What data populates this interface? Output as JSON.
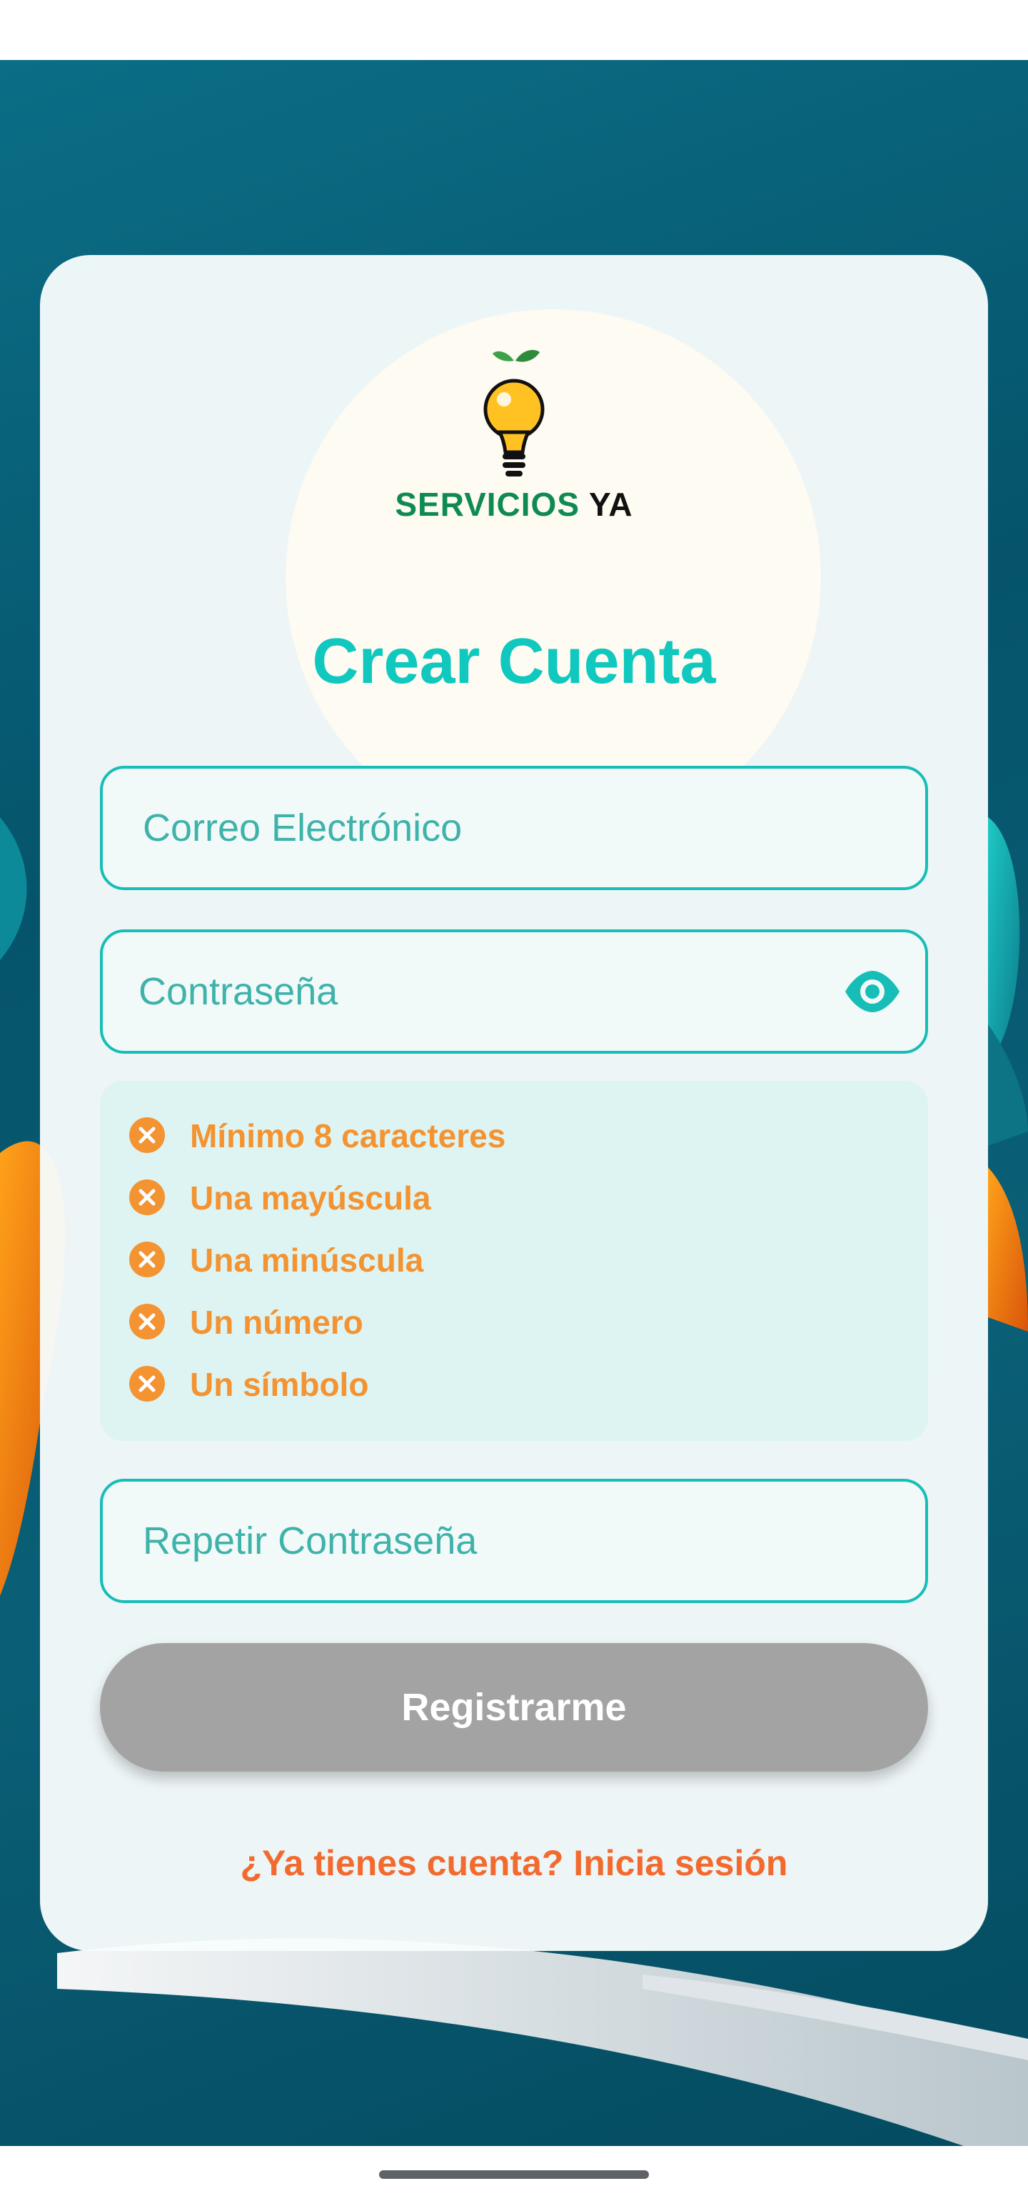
{
  "brand": {
    "word1": "SERVICIOS",
    "word2": "YA"
  },
  "form": {
    "title": "Crear Cuenta",
    "email_placeholder": "Correo Electrónico",
    "password_placeholder": "Contraseña",
    "repeat_placeholder": "Repetir Contraseña",
    "submit_label": "Registrarme",
    "submit_enabled": false,
    "password_visibility_icon": "eye-icon"
  },
  "requirements": [
    {
      "label": "Mínimo 8 caracteres",
      "met": false,
      "icon": "close-circle-icon"
    },
    {
      "label": "Una mayúscula",
      "met": false,
      "icon": "close-circle-icon"
    },
    {
      "label": "Una minúscula",
      "met": false,
      "icon": "close-circle-icon"
    },
    {
      "label": "Un número",
      "met": false,
      "icon": "close-circle-icon"
    },
    {
      "label": "Un símbolo",
      "met": false,
      "icon": "close-circle-icon"
    }
  ],
  "login_link": "¿Ya tienes cuenta? Inicia sesión",
  "colors": {
    "accent": "#17bdb7",
    "title": "#10c8be",
    "requirement_unmet": "#f39332",
    "link": "#f26a2e",
    "button_disabled": "#a3a3a3"
  }
}
